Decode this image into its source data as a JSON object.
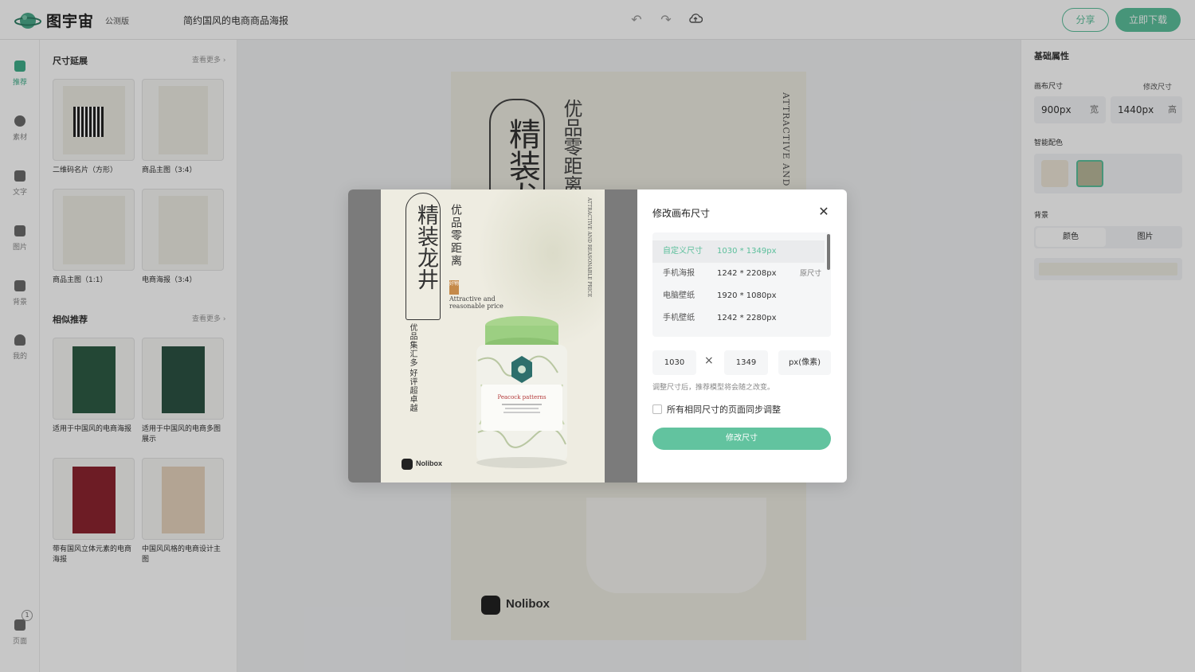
{
  "app": {
    "name": "图宇宙",
    "edition": "公测版",
    "document_title": "简约国风的电商商品海报"
  },
  "toolbar": {
    "share_label": "分享",
    "download_label": "立即下载"
  },
  "leftnav": {
    "items": [
      {
        "label": "推荐",
        "active": true
      },
      {
        "label": "素材"
      },
      {
        "label": "文字"
      },
      {
        "label": "图片"
      },
      {
        "label": "背景"
      },
      {
        "label": "我的"
      }
    ],
    "pages_label": "页面",
    "pages_count": "1"
  },
  "templates": {
    "section1_title": "尺寸延展",
    "section1_more": "查看更多",
    "section1_items": [
      "二维码名片（方形）",
      "商品主图（3:4）",
      "商品主图（1:1）",
      "电商海报（3:4）"
    ],
    "section2_title": "相似推荐",
    "section2_more": "查看更多",
    "section2_items": [
      "适用于中国风的电商海报",
      "适用于中国风的电商多图展示",
      "带有国风立体元素的电商海报",
      "中国风风格的电商设计主图"
    ]
  },
  "right_panel": {
    "title": "基础属性",
    "canvas_size_label": "画布尺寸",
    "modify_size_link": "修改尺寸",
    "width_value": "900px",
    "width_unit": "宽",
    "height_value": "1440px",
    "height_unit": "高",
    "smart_color_label": "智能配色",
    "swatches": [
      "#ece4d6",
      "#b9b89a"
    ],
    "background_label": "背景",
    "bg_tabs": [
      "颜色",
      "图片"
    ]
  },
  "modal": {
    "title": "修改画布尺寸",
    "sizes": [
      {
        "name": "自定义尺寸",
        "dim": "1030 * 1349px",
        "selected": true
      },
      {
        "name": "手机海报",
        "dim": "1242 * 2208px",
        "tag": "原尺寸"
      },
      {
        "name": "电脑壁纸",
        "dim": "1920 * 1080px"
      },
      {
        "name": "手机壁纸",
        "dim": "1242 * 2280px"
      }
    ],
    "width_input": "1030",
    "height_input": "1349",
    "unit_label": "px(像素)",
    "hint": "调整尺寸后，推荐模型将会随之改变。",
    "sync_label": "所有相同尺寸的页面同步调整",
    "confirm_label": "修改尺寸"
  },
  "poster": {
    "title_chars": "精装龙井",
    "subtitle": "优品零距离",
    "tagline_en_1": "Attractive and",
    "tagline_en_2": "reasonable price",
    "side_text_1": "优品集汇多",
    "side_text_2": "好评超卓越",
    "vertical_en": "ATTRACTIVE AND REASONABLE PRICE",
    "brand": "Nolibox",
    "can_label": "Peacock patterns",
    "seal": "好物"
  },
  "colors": {
    "accent": "#5bbf9b",
    "lid_green": "#9ccf82"
  }
}
